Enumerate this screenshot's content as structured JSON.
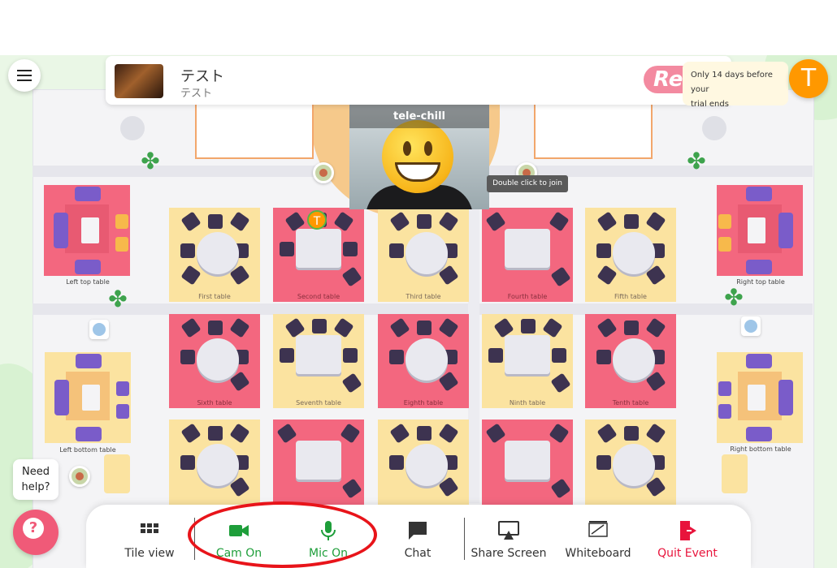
{
  "event": {
    "title": "テスト",
    "subtitle": "テスト",
    "logo_text": "Re"
  },
  "trial": {
    "line1": "Only 14 days before your",
    "line2": "trial ends"
  },
  "user": {
    "avatar_letter": "T",
    "marker_letter": "T"
  },
  "video": {
    "name": "tele-chill",
    "join_tooltip": "Double click to join"
  },
  "tables": [
    {
      "label": "First table"
    },
    {
      "label": "Second table"
    },
    {
      "label": "Third table"
    },
    {
      "label": "Fourth table"
    },
    {
      "label": "Fifth table"
    },
    {
      "label": "Sixth table"
    },
    {
      "label": "Seventh table"
    },
    {
      "label": "Eighth table"
    },
    {
      "label": "Ninth table"
    },
    {
      "label": "Tenth table"
    }
  ],
  "side_tables": {
    "left_top": "Left top table",
    "left_bottom": "Left bottom table",
    "right_top": "Right top table",
    "right_bottom": "Right bottom table"
  },
  "help": {
    "line1": "Need",
    "line2": "help?"
  },
  "toolbar": {
    "tile_view": "Tile view",
    "cam": "Cam On",
    "mic": "Mic On",
    "chat": "Chat",
    "share": "Share Screen",
    "whiteboard": "Whiteboard",
    "quit": "Quit Event"
  },
  "colors": {
    "active_green": "#1e9e3a",
    "quit_red": "#e8143c",
    "highlight": "#e8141a"
  }
}
